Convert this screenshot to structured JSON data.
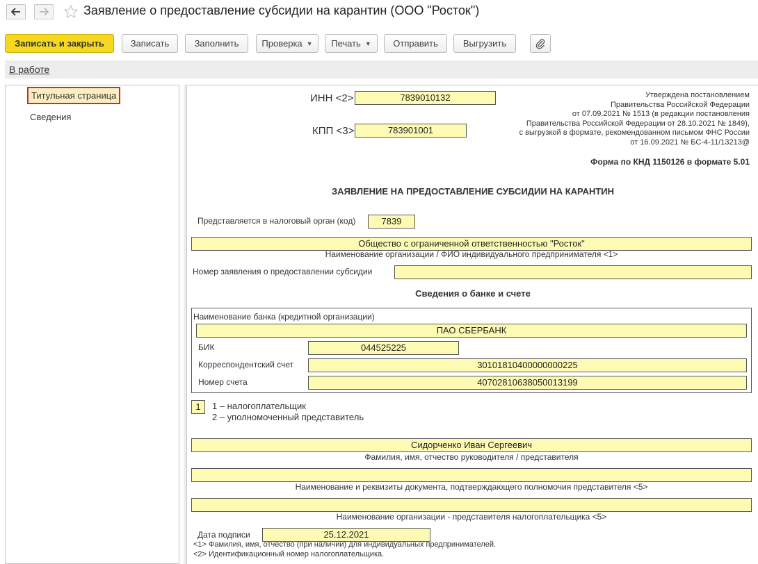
{
  "window": {
    "title": "Заявление о предоставление субсидии на карантин (ООО \"Росток\")"
  },
  "toolbar": {
    "save_close": "Записать и закрыть",
    "save": "Записать",
    "fill": "Заполнить",
    "check": "Проверка",
    "print": "Печать",
    "send": "Отправить",
    "export": "Выгрузить"
  },
  "status": {
    "label": "В работе"
  },
  "sidebar": {
    "items": [
      {
        "label": "Титульная страница"
      },
      {
        "label": "Сведения"
      }
    ]
  },
  "form": {
    "inn_label": "ИНН <2>",
    "inn": "7839010132",
    "kpp_label": "КПП <3>",
    "kpp": "783901001",
    "approval_lines": [
      "Утверждена постановлением",
      "Правительства Российской Федерации",
      "от 07.09.2021 № 1513 (в редакции постановления",
      "Правительства Российской Федерации от 28.10.2021 № 1849),",
      "с выгрузкой в формате, рекомендованном письмом ФНС России",
      "от 16.09.2021 № БС-4-11/13213@"
    ],
    "knd": "Форма по КНД 1150126 в формате 5.01",
    "heading": "ЗАЯВЛЕНИЕ НА ПРЕДОСТАВЛЕНИЕ СУБСИДИИ НА КАРАНТИН",
    "tax_office_label": "Представляется в налоговый орган (код)",
    "tax_office": "7839",
    "org_name": "Общество с ограниченной ответственностью \"Росток\"",
    "org_name_caption": "Наименование организации / ФИО индивидуального предпринимателя <1>",
    "app_number_label": "Номер заявления о предоставлении субсидии",
    "app_number": "",
    "bank_section_title": "Сведения о банке и счете",
    "bank_name_label": "Наименование банка (кредитной организации)",
    "bank_name": "ПАО СБЕРБАНК",
    "bik_label": "БИК",
    "bik": "044525225",
    "corr_label": "Корреспондентский счет",
    "corr": "30101810400000000225",
    "account_label": "Номер счета",
    "account": "40702810638050013199",
    "signer_code": "1",
    "signer_options": [
      "1 – налогоплательщик",
      "2 – уполномоченный представитель"
    ],
    "head_name": "Сидорченко Иван Сергеевич",
    "head_caption": "Фамилия, имя, отчество руководителя / представителя",
    "doc_value": "",
    "doc_caption": "Наименование и реквизиты документа, подтверждающего полномочия представителя <5>",
    "rep_org_value": "",
    "rep_org_caption": "Наименование организации - представителя налогоплательщика <5>",
    "sign_date_label": "Дата подписи",
    "sign_date": "25.12.2021",
    "footnotes": [
      "<1> Фамилия, имя, отчество (при наличии) для индивидуальных предпринимателей.",
      "<2> Идентификационный номер налогоплательщика."
    ]
  }
}
